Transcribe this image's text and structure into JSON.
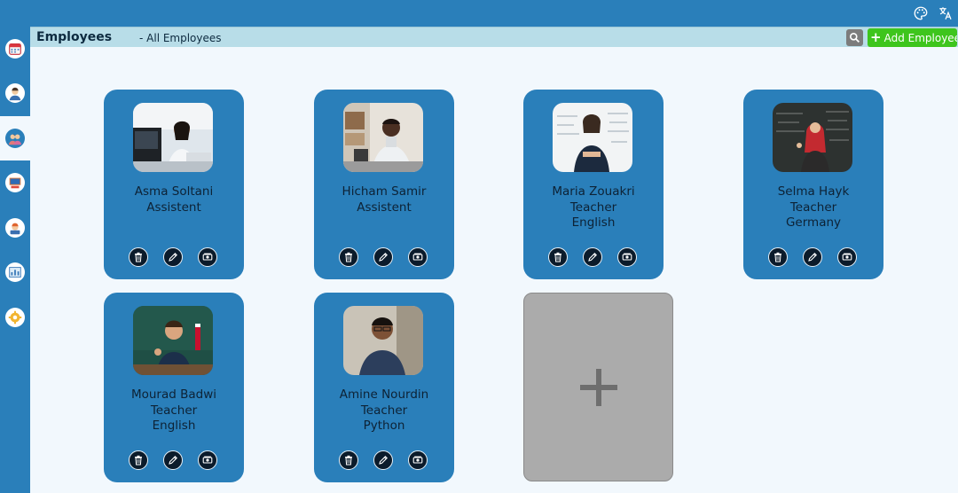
{
  "header": {
    "title": "Employees",
    "subtitle": "- All Employees",
    "add_button_label": "Add Employee",
    "add_button_icon": "plus-icon",
    "search_icon": "search-icon"
  },
  "topbar": {
    "icons": [
      "palette-icon",
      "translate-icon"
    ]
  },
  "sidebar": {
    "items": [
      {
        "name": "calendar",
        "icon": "calendar-icon",
        "active": false
      },
      {
        "name": "teacher",
        "icon": "teacher-icon",
        "active": false
      },
      {
        "name": "employees",
        "icon": "employees-icon",
        "active": true
      },
      {
        "name": "classroom",
        "icon": "classroom-icon",
        "active": false
      },
      {
        "name": "students",
        "icon": "students-icon",
        "active": false
      },
      {
        "name": "reports",
        "icon": "chart-icon",
        "active": false
      },
      {
        "name": "settings",
        "icon": "settings-icon",
        "active": false
      }
    ]
  },
  "employees": [
    {
      "name": "Asma Soltani",
      "role": "Assistent",
      "detail": ""
    },
    {
      "name": "Hicham Samir",
      "role": "Assistent",
      "detail": ""
    },
    {
      "name": "Maria Zouakri",
      "role": "Teacher",
      "detail": "English"
    },
    {
      "name": "Selma Hayk",
      "role": "Teacher",
      "detail": "Germany"
    },
    {
      "name": "Mourad Badwi",
      "role": "Teacher",
      "detail": "English"
    },
    {
      "name": "Amine Nourdin",
      "role": "Teacher",
      "detail": "Python"
    }
  ],
  "card_actions": [
    "trash-icon",
    "edit-pencil-icon",
    "payment-icon"
  ],
  "colors": {
    "brand_blue": "#2a7fba",
    "header_bg": "#b8dde8",
    "main_bg": "#f2f8fd",
    "add_green": "#3ec51d",
    "add_card_gray": "#ababab"
  }
}
